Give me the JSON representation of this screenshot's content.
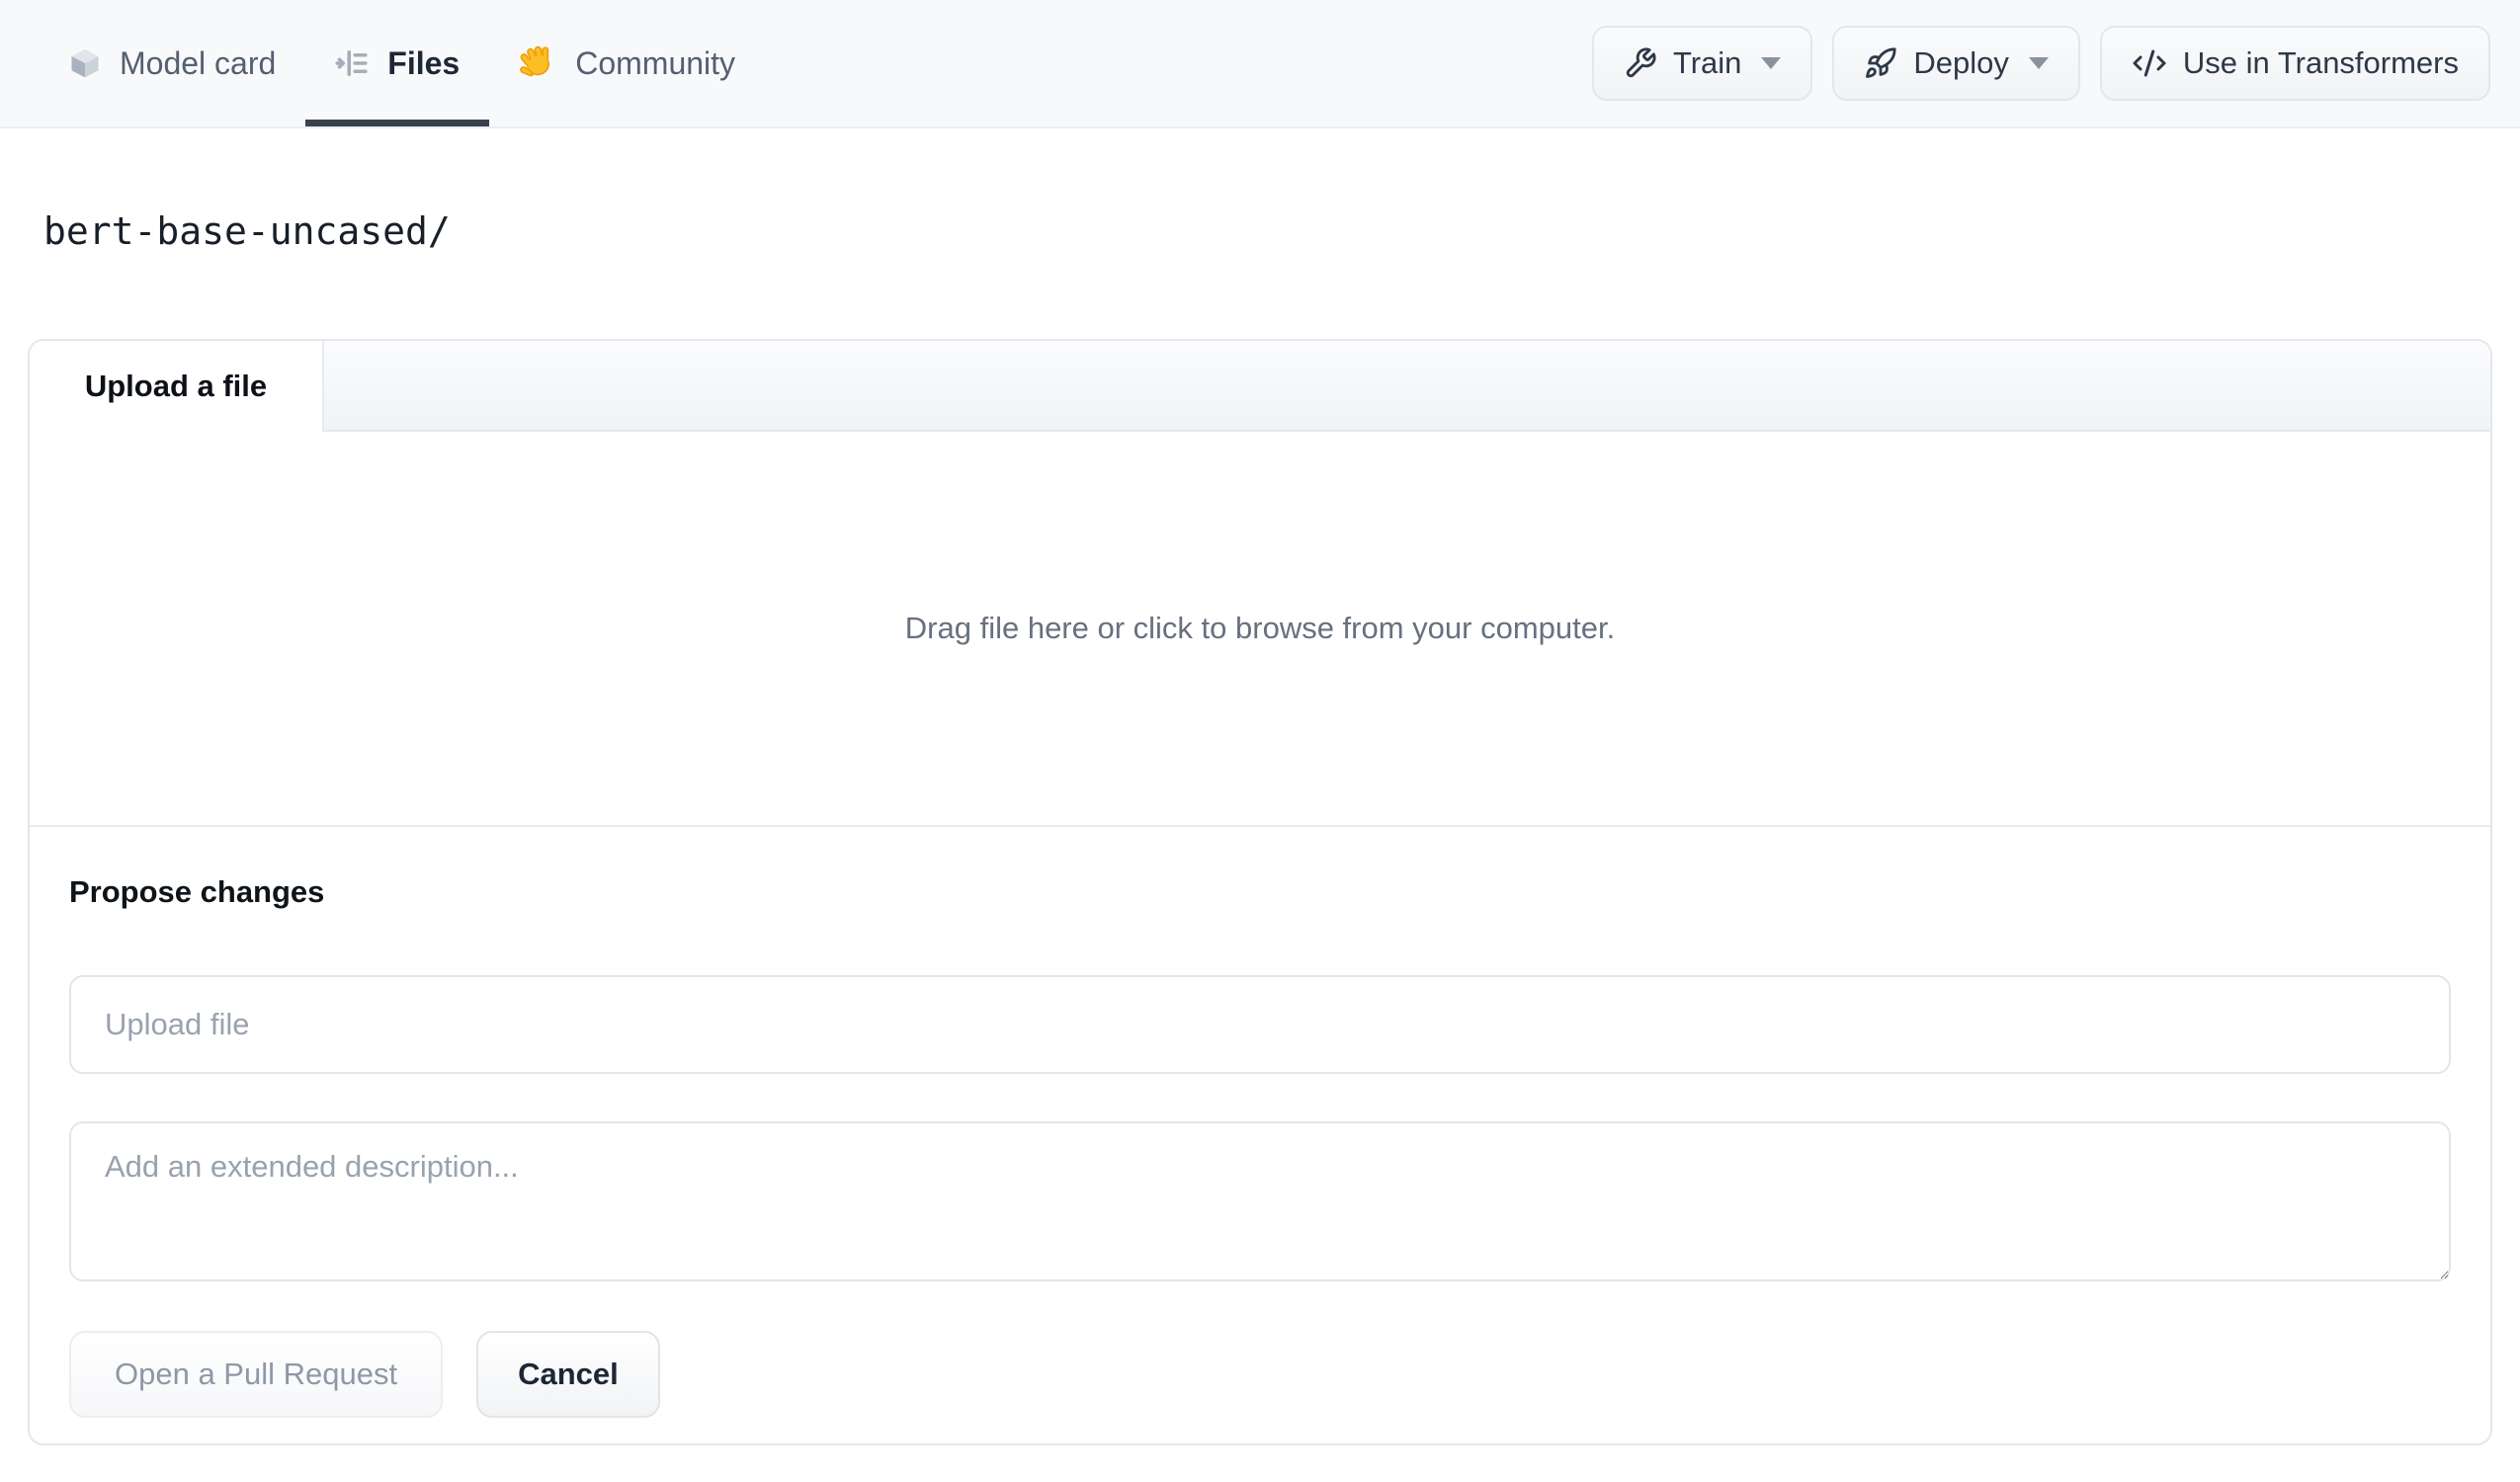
{
  "header": {
    "tabs": [
      {
        "label": "Model card",
        "icon": "cube-icon",
        "active": false
      },
      {
        "label": "Files",
        "icon": "file-tree-icon",
        "active": true
      },
      {
        "label": "Community",
        "icon": "waving-hand-icon",
        "active": false
      }
    ],
    "actions": [
      {
        "label": "Train",
        "icon": "wrench-icon",
        "has_dropdown": true
      },
      {
        "label": "Deploy",
        "icon": "rocket-icon",
        "has_dropdown": true
      },
      {
        "label": "Use in Transformers",
        "icon": "code-icon",
        "has_dropdown": false
      }
    ]
  },
  "breadcrumb": {
    "path": "bert-base-uncased/"
  },
  "upload_panel": {
    "tab_label": "Upload a file",
    "dropzone_text": "Drag file here or click to browse from your computer.",
    "propose": {
      "heading": "Propose changes",
      "file_input_placeholder": "Upload file",
      "file_input_value": "",
      "description_placeholder": "Add an extended description...",
      "description_value": "",
      "primary_button": "Open a Pull Request",
      "secondary_button": "Cancel"
    }
  },
  "colors": {
    "header_bg": "#f8f9fb",
    "active_tab_underline": "#39414f",
    "panel_border": "#e5e7ec",
    "muted_text": "#68707e",
    "hand_emoji_yellow": "#fbbf24"
  }
}
